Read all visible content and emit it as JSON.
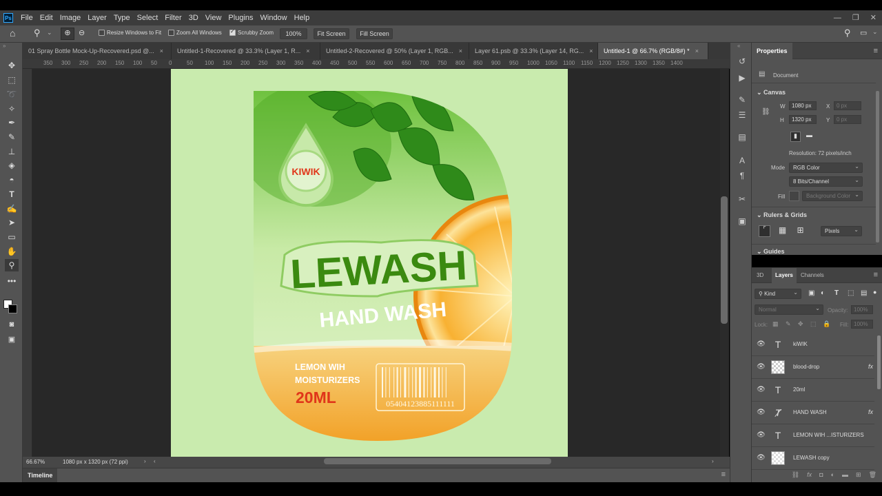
{
  "app": {
    "logo": "Ps"
  },
  "menu": [
    "File",
    "Edit",
    "Image",
    "Layer",
    "Type",
    "Select",
    "Filter",
    "3D",
    "View",
    "Plugins",
    "Window",
    "Help"
  ],
  "options": {
    "resize_windows": "Resize Windows to Fit",
    "zoom_all": "Zoom All Windows",
    "scrubby_zoom": "Scrubby Zoom",
    "zoom_value": "100%",
    "fit_screen": "Fit Screen",
    "fill_screen": "Fill Screen"
  },
  "tabs": [
    {
      "label": "01 Spray Bottle Mock-Up-Recovered.psd @..."
    },
    {
      "label": "Untitled-1-Recovered @ 33.3% (Layer 1, R..."
    },
    {
      "label": "Untitled-2-Recovered @ 50% (Layer 1, RGB..."
    },
    {
      "label": "Layer 61.psb @ 33.3% (Layer 14, RG..."
    },
    {
      "label": "Untitled-1 @ 66.7% (RGB/8#) *"
    }
  ],
  "ruler": [
    "350",
    "300",
    "250",
    "200",
    "150",
    "100",
    "50",
    "0",
    "50",
    "100",
    "150",
    "200",
    "250",
    "300",
    "350",
    "400",
    "450",
    "500",
    "550",
    "600",
    "650",
    "700",
    "750",
    "800",
    "850",
    "900",
    "950",
    "1000",
    "1050",
    "1100",
    "1150",
    "1200",
    "1250",
    "1300",
    "1350",
    "1400"
  ],
  "artwork": {
    "brand": "KIWIK",
    "title": "LEWASH",
    "subtitle": "HAND WASH",
    "desc_line1": "LEMON WIH",
    "desc_line2": "MOISTURIZERS",
    "volume": "20ML",
    "barcode_digits": "05404123885111111"
  },
  "status": {
    "zoom": "66.67%",
    "doc_size": "1080 px x 1320 px (72 ppi)"
  },
  "timeline": {
    "label": "Timeline"
  },
  "properties": {
    "tab": "Properties",
    "document_label": "Document",
    "canvas_section": "Canvas",
    "w_label": "W",
    "w_value": "1080 px",
    "h_label": "H",
    "h_value": "1320 px",
    "x_label": "X",
    "x_value": "0 px",
    "y_label": "Y",
    "y_value": "0 px",
    "resolution": "Resolution: 72 pixels/inch",
    "mode_label": "Mode",
    "mode_value": "RGB Color",
    "bits_value": "8 Bits/Channel",
    "fill_label": "Fill",
    "fill_value": "Background Color",
    "rulers_section": "Rulers & Grids",
    "units_value": "Pixels",
    "guides_section": "Guides"
  },
  "layers_panel": {
    "tabs": [
      "3D",
      "Layers",
      "Channels"
    ],
    "filter_kind": "Kind",
    "blend_mode": "Normal",
    "opacity_label": "Opacity:",
    "opacity_value": "100%",
    "lock_label": "Lock:",
    "fill_label": "Fill:",
    "fill_value": "100%",
    "items": [
      {
        "name": "kiWIK",
        "type": "text",
        "fx": ""
      },
      {
        "name": "blood-drop",
        "type": "smart",
        "fx": "fx"
      },
      {
        "name": "20ml",
        "type": "text",
        "fx": ""
      },
      {
        "name": "HAND WASH",
        "type": "warp-text",
        "fx": "fx"
      },
      {
        "name": "LEMON WIH ...ISTURIZERS",
        "type": "text",
        "fx": ""
      },
      {
        "name": "LEWASH copy",
        "type": "image",
        "fx": ""
      }
    ]
  },
  "colors": {
    "canvas_bg": "#c9ebae",
    "brand_green": "#3b8a10",
    "accent_red": "#e0361a",
    "orange": "#f3a934"
  }
}
